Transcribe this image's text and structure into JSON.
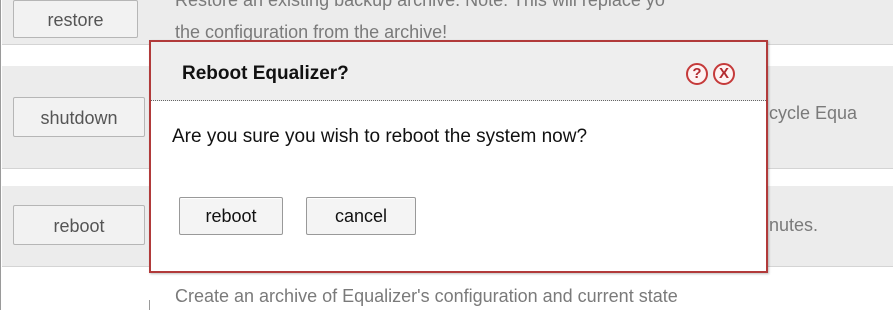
{
  "background": {
    "rows": [
      {
        "button": "restore",
        "description": "Restore an existing backup archive. Note: This will replace yo",
        "description_line2": "the configuration from the archive!"
      },
      {
        "button": "shutdown",
        "description": "cycle Equa"
      },
      {
        "button": "reboot",
        "description": "nutes."
      },
      {
        "button": "",
        "description": "Create an archive of Equalizer's configuration and current state"
      }
    ]
  },
  "dialog": {
    "title": "Reboot Equalizer?",
    "message": "Are you sure you wish to reboot the system now?",
    "help_icon": "?",
    "close_icon": "X",
    "buttons": {
      "confirm": "reboot",
      "cancel": "cancel"
    }
  },
  "colors": {
    "dialog_border": "#b13a3a",
    "icon_red": "#c53a3a",
    "row_bg": "#ececec"
  }
}
